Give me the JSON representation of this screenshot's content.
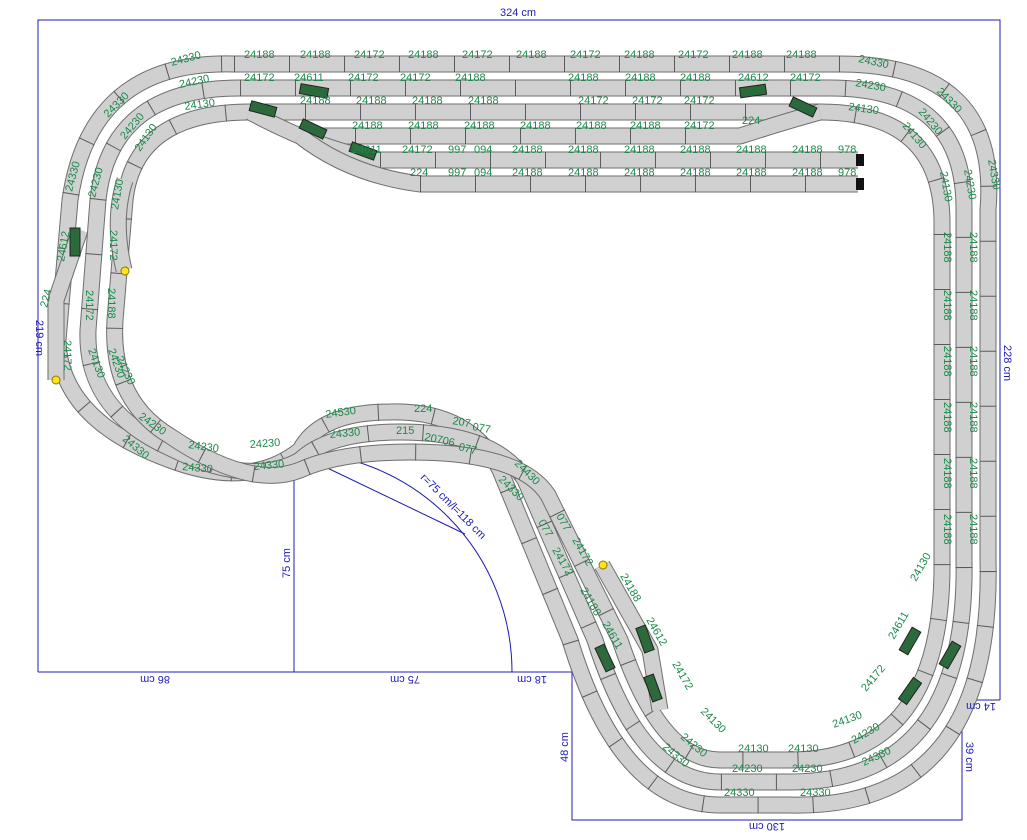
{
  "dimensions": {
    "top": "324 cm",
    "right_upper": "228 cm",
    "left": "219 cm",
    "left_bottom": "86 cm",
    "radius_bottom": "75 cm",
    "radius_offset": "18 cm",
    "inner_height": "75 cm",
    "lower_left": "48 cm",
    "bottom": "130 cm",
    "right_lower": "39 cm",
    "right_step": "14 cm",
    "radius_note": "r=75 cm/l=118 cm"
  },
  "track_labels": {
    "top_outer": [
      "24330",
      "24188",
      "24188",
      "24172",
      "24188",
      "24172",
      "24188",
      "24172",
      "24188",
      "24172",
      "24188",
      "24188",
      "24330"
    ],
    "row2": [
      "24230",
      "24172",
      "24611",
      "24172",
      "24172",
      "24188",
      "24188",
      "24188",
      "24188",
      "24612",
      "24172",
      "24230"
    ],
    "row3": [
      "24130",
      "24188",
      "24188",
      "24188",
      "24188",
      "24172",
      "24172",
      "24172",
      "24130"
    ],
    "row4": [
      "24188",
      "24188",
      "24188",
      "24188",
      "24188",
      "24188",
      "24172",
      "224"
    ],
    "siding_a": [
      "24611",
      "24172",
      "997",
      "094",
      "24188",
      "24188",
      "24188",
      "24188",
      "24188",
      "24188",
      "978"
    ],
    "siding_b": [
      "224",
      "997",
      "094",
      "24188",
      "24188",
      "24188",
      "24188",
      "24188",
      "24188",
      "978"
    ],
    "left_curves": [
      "24330",
      "24330",
      "24330",
      "24230",
      "24230",
      "24230",
      "24130",
      "24130",
      "24130"
    ],
    "left_straights": [
      "24612",
      "224",
      "24172",
      "24188",
      "24172",
      "24172"
    ],
    "right_curves": [
      "24330",
      "24330",
      "24230",
      "24230",
      "24130",
      "24130"
    ],
    "right_straights": [
      "24188",
      "24188",
      "24188",
      "24188",
      "24188",
      "24188",
      "24188",
      "24188",
      "24188",
      "24188",
      "24188",
      "24188"
    ],
    "middle": [
      "24530",
      "224",
      "207",
      "077",
      "24330",
      "215",
      "20706",
      "077",
      "24230",
      "24230",
      "24330",
      "24330",
      "24230",
      "24230"
    ],
    "diagonal": [
      "24430",
      "24330",
      "077",
      "077",
      "24172",
      "24172",
      "24188",
      "24188",
      "24612",
      "24611"
    ],
    "bottom": [
      "24172",
      "24130",
      "24130",
      "24130",
      "24130",
      "24230",
      "24230",
      "24230",
      "24330",
      "24330",
      "24330",
      "24330",
      "24130",
      "24172",
      "24611",
      "24230"
    ]
  }
}
